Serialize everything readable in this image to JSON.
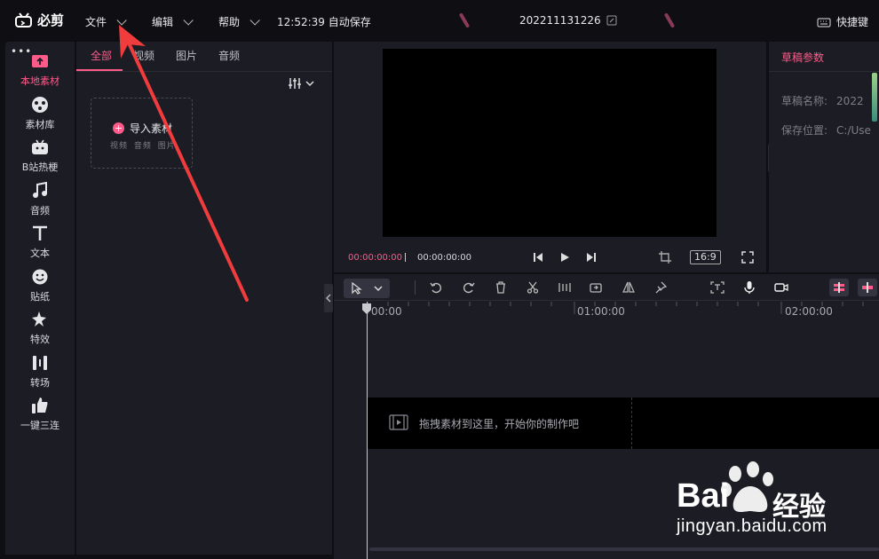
{
  "app": {
    "name": "必剪"
  },
  "menu": [
    {
      "label": "文件"
    },
    {
      "label": "编辑"
    },
    {
      "label": "帮助"
    }
  ],
  "autosave": "12:52:39 自动保存",
  "project_title": "202211131226",
  "shortcut_label": "快捷键",
  "sidebar": {
    "items": [
      {
        "label": "本地素材",
        "icon": "upload-icon",
        "active": true
      },
      {
        "label": "素材库",
        "icon": "material-library-icon"
      },
      {
        "label": "B站热梗",
        "icon": "bilibili-tv-icon"
      },
      {
        "label": "音频",
        "icon": "music-note-icon"
      },
      {
        "label": "文本",
        "icon": "text-icon"
      },
      {
        "label": "贴纸",
        "icon": "sticker-icon"
      },
      {
        "label": "特效",
        "icon": "effects-star-icon"
      },
      {
        "label": "转场",
        "icon": "transition-icon"
      },
      {
        "label": "一键三连",
        "icon": "thumbs-up-icon"
      }
    ]
  },
  "material": {
    "tabs": [
      {
        "label": "全部",
        "active": true
      },
      {
        "label": "视频"
      },
      {
        "label": "图片"
      },
      {
        "label": "音频"
      }
    ],
    "import_title": "导入素材",
    "import_sub": "视频 音频 图片"
  },
  "preview": {
    "current_time": "00:00:00:00",
    "total_time": "00:00:00:00",
    "ratio": "16:9"
  },
  "params": {
    "tab": "草稿参数",
    "rows": [
      {
        "label": "草稿名称:",
        "value": "2022"
      },
      {
        "label": "保存位置:",
        "value": "C:/Use"
      }
    ]
  },
  "timeline": {
    "ruler": [
      "00:00",
      "01:00:00",
      "02:00:00"
    ],
    "drop_hint": "拖拽素材到这里，开始你的制作吧"
  },
  "watermark": {
    "brand": "Bai",
    "brand_cn": "经验",
    "url": "jingyan.baidu.com"
  },
  "colors": {
    "accent": "#ff5b8a",
    "panel": "#1c1c24",
    "background": "#0f0f13",
    "arrow": "#f03c3c"
  }
}
